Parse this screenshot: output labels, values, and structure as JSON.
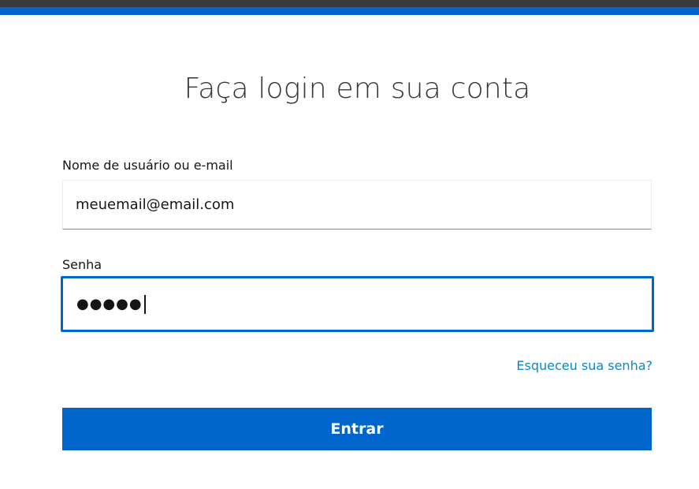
{
  "page": {
    "title": "Faça login em sua conta"
  },
  "form": {
    "username": {
      "label": "Nome de usuário ou e-mail",
      "value": "meuemail@email.com"
    },
    "password": {
      "label": "Senha",
      "masked_value": "●●●●●"
    },
    "forgot_password_label": "Esqueceu sua senha?",
    "submit_label": "Entrar"
  },
  "colors": {
    "accent": "#0066cc",
    "link": "#0a87c8",
    "header_dark": "#3a3a3a"
  }
}
